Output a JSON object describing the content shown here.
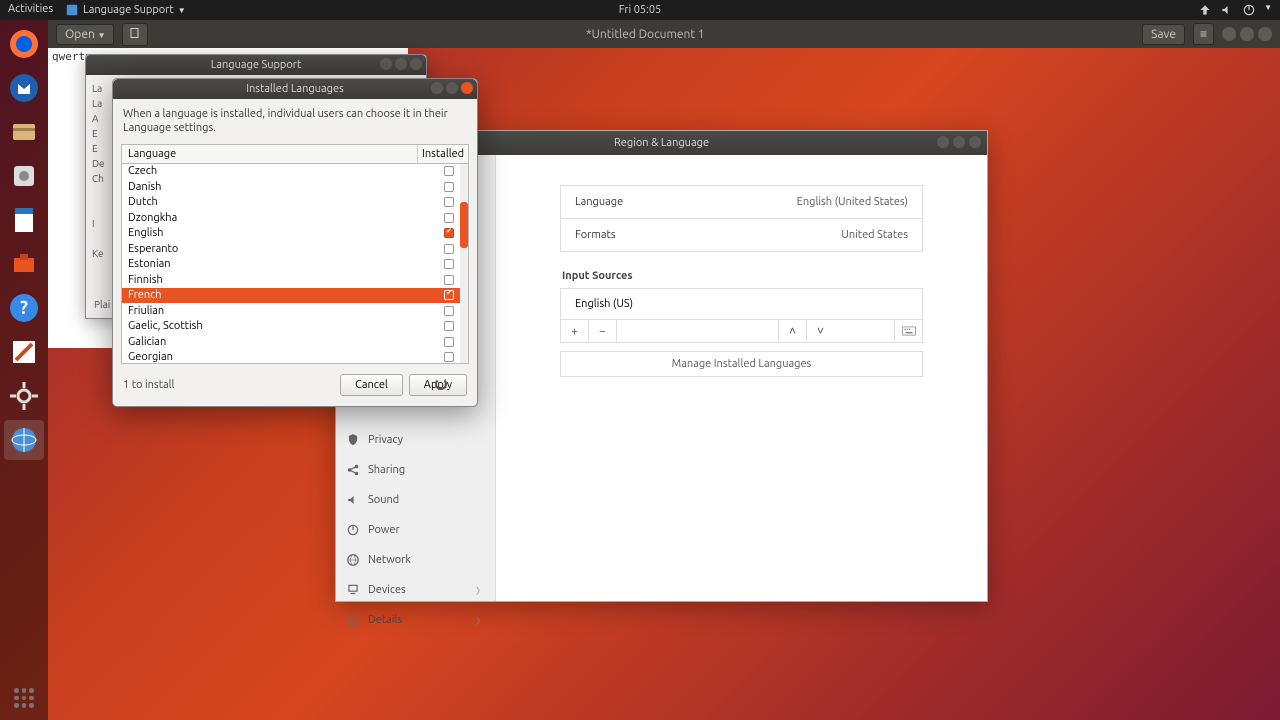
{
  "topbar": {
    "activities": "Activities",
    "app_indicator": "Language Support",
    "clock": "Fri 05:05"
  },
  "gedit": {
    "open": "Open",
    "doc_title": "*Untitled Document 1",
    "save": "Save",
    "content": "qwerty"
  },
  "lang_support": {
    "title": "Language Support"
  },
  "installed_languages": {
    "title": "Installed Languages",
    "description": "When a language is installed, individual users can choose it in their Language settings.",
    "col_language": "Language",
    "col_installed": "Installed",
    "rows": [
      {
        "name": "Czech",
        "installed": false,
        "selected": false
      },
      {
        "name": "Danish",
        "installed": false,
        "selected": false
      },
      {
        "name": "Dutch",
        "installed": false,
        "selected": false
      },
      {
        "name": "Dzongkha",
        "installed": false,
        "selected": false
      },
      {
        "name": "English",
        "installed": true,
        "selected": false
      },
      {
        "name": "Esperanto",
        "installed": false,
        "selected": false
      },
      {
        "name": "Estonian",
        "installed": false,
        "selected": false
      },
      {
        "name": "Finnish",
        "installed": false,
        "selected": false
      },
      {
        "name": "French",
        "installed": true,
        "selected": true
      },
      {
        "name": "Friulian",
        "installed": false,
        "selected": false
      },
      {
        "name": "Gaelic, Scottish",
        "installed": false,
        "selected": false
      },
      {
        "name": "Galician",
        "installed": false,
        "selected": false
      },
      {
        "name": "Georgian",
        "installed": false,
        "selected": false
      }
    ],
    "status": "1 to install",
    "cancel": "Cancel",
    "apply": "Apply"
  },
  "region_language": {
    "title": "Region & Language",
    "language_label": "Language",
    "language_value": "English (United States)",
    "formats_label": "Formats",
    "formats_value": "United States",
    "input_sources_label": "Input Sources",
    "input_source_0": "English (US)",
    "manage_btn": "Manage Installed Languages",
    "sidebar": [
      {
        "label": "Privacy",
        "chevron": false
      },
      {
        "label": "Sharing",
        "chevron": false
      },
      {
        "label": "Sound",
        "chevron": false
      },
      {
        "label": "Power",
        "chevron": false
      },
      {
        "label": "Network",
        "chevron": false
      },
      {
        "label": "Devices",
        "chevron": true
      },
      {
        "label": "Details",
        "chevron": true
      }
    ]
  },
  "gedit_status": {
    "left": "Plai"
  }
}
